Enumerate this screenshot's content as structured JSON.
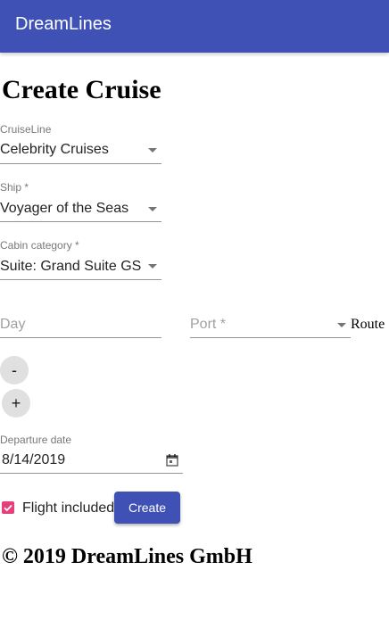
{
  "app": {
    "title": "DreamLines"
  },
  "page": {
    "title": "Create Cruise"
  },
  "form": {
    "cruise_line": {
      "label": "CruiseLine",
      "value": "Celebrity Cruises"
    },
    "ship": {
      "label": "Ship *",
      "value": "Voyager of the Seas"
    },
    "cabin_category": {
      "label": "Cabin category *",
      "value": "Suite: Grand Suite GS"
    },
    "route": {
      "day_placeholder": "Day",
      "port_placeholder": "Port *",
      "label": "Route"
    },
    "remove_button": "-",
    "add_button": "+",
    "departure_date": {
      "label": "Departure date",
      "value": "8/14/2019",
      "icon": "calendar-icon"
    },
    "flight_included": {
      "label": "Flight included",
      "checked": true
    },
    "create_button": "Create"
  },
  "footer": {
    "text": "© 2019 DreamLines GmbH"
  },
  "colors": {
    "primary": "#3f51b5",
    "checkbox": "#e6407a",
    "button_grey": "#e0e0e0"
  }
}
